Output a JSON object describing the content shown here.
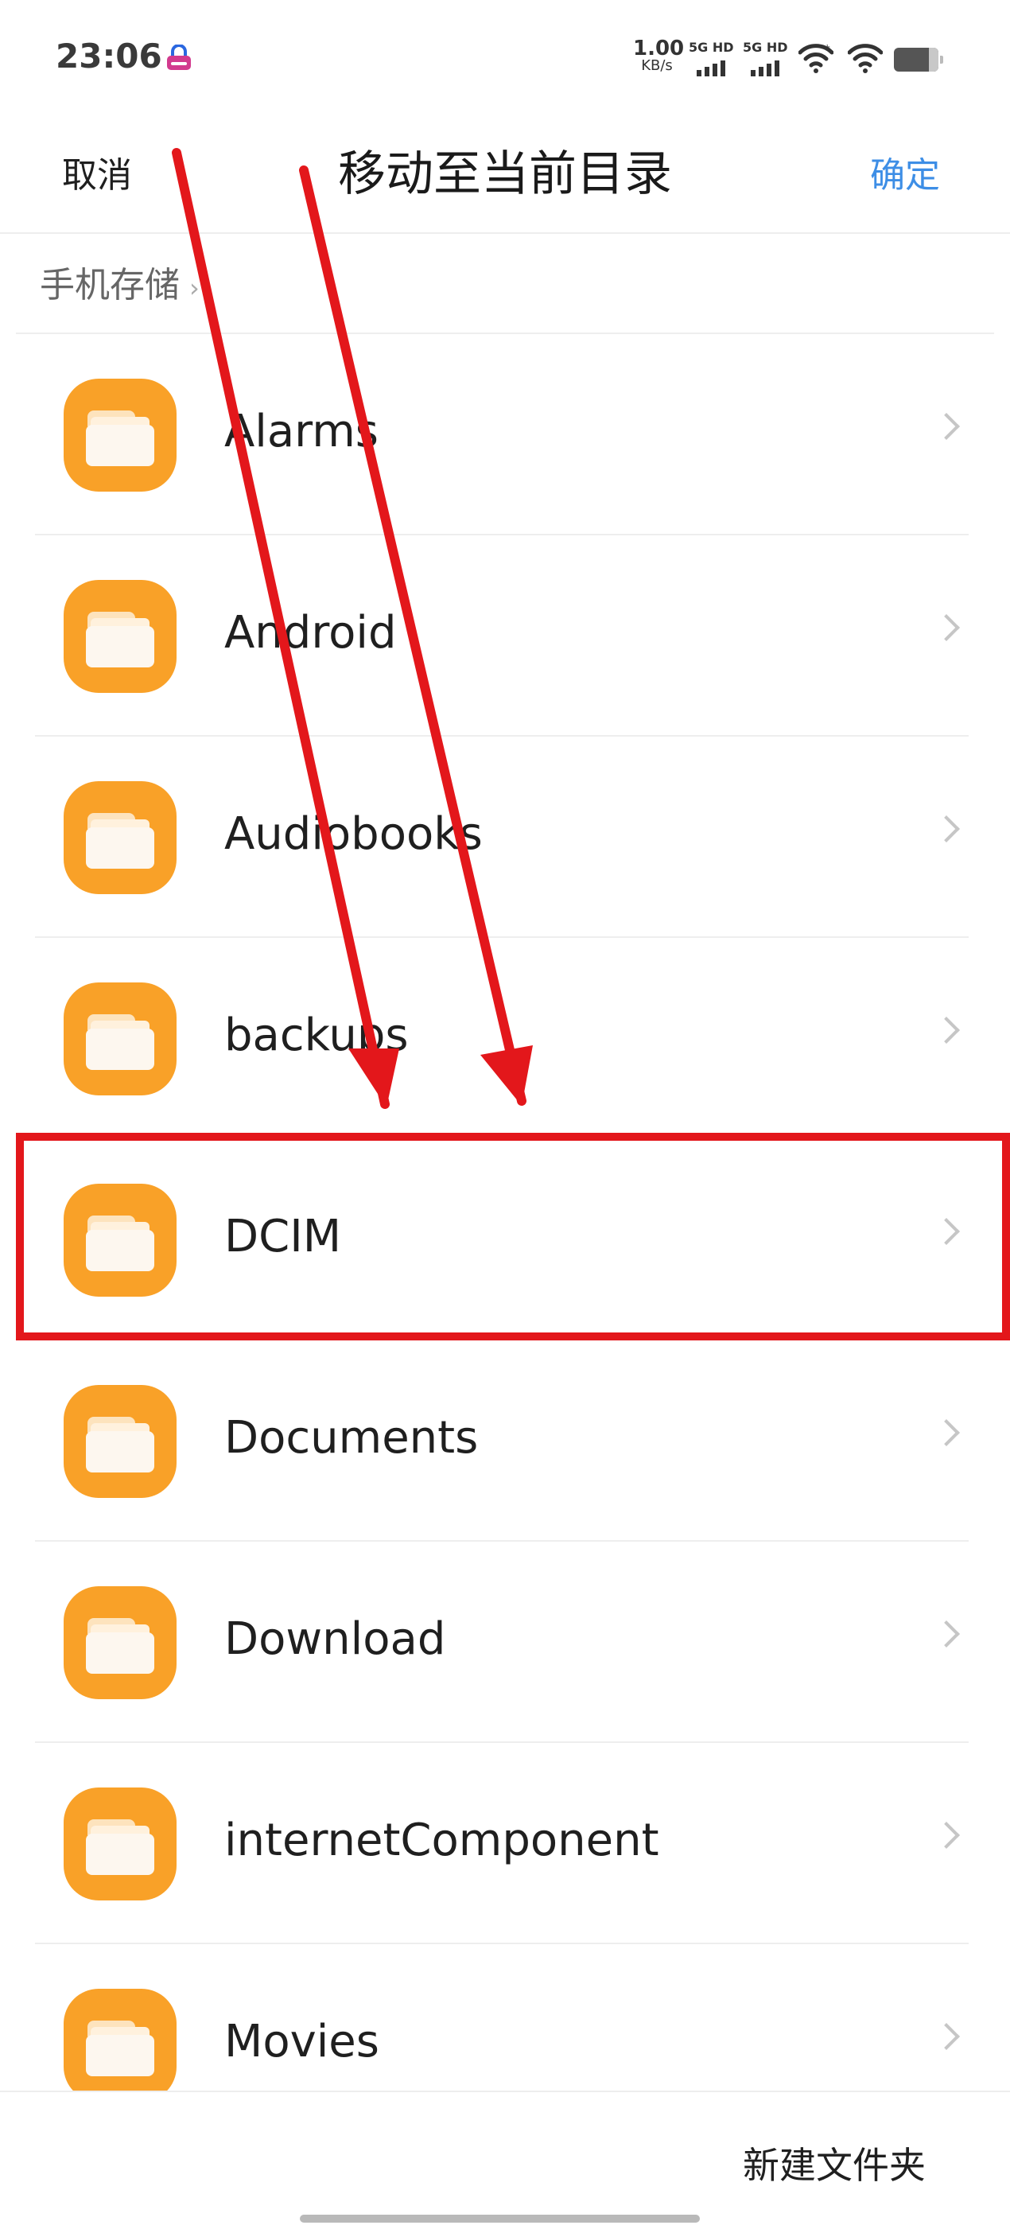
{
  "status_bar": {
    "time": "23:06",
    "net_speed_value": "1.00",
    "net_speed_unit": "KB/s",
    "sim1_label": "5G HD",
    "sim2_label": "5G HD",
    "icons": [
      "app-notification-icon",
      "signal-icon",
      "signal-icon",
      "wifi-icon",
      "wifi-icon",
      "battery-icon"
    ]
  },
  "header": {
    "cancel_label": "取消",
    "title": "移动至当前目录",
    "confirm_label": "确定"
  },
  "breadcrumb": {
    "label": "手机存储",
    "chevron": "›"
  },
  "folders": [
    {
      "name": "Alarms"
    },
    {
      "name": "Android"
    },
    {
      "name": "Audiobooks"
    },
    {
      "name": "backups"
    },
    {
      "name": "DCIM",
      "highlighted": true
    },
    {
      "name": "Documents"
    },
    {
      "name": "Download"
    },
    {
      "name": "internetComponent"
    },
    {
      "name": "Movies"
    }
  ],
  "bottom_bar": {
    "new_folder_label": "新建文件夹"
  },
  "colors": {
    "accent": "#3d8ee6",
    "folder_orange": "#f9a128",
    "annotation_red": "#e3171b"
  }
}
